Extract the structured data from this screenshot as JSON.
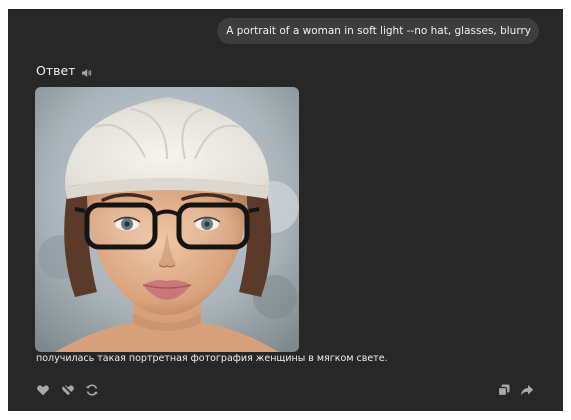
{
  "conversation": {
    "user_prompt": "A portrait of a woman in soft light --no hat, glasses, blurry",
    "answer_title": "Ответ",
    "image_caption": "получилась такая портретная фотография женщины в мягком свете."
  },
  "icons": {
    "speaker": "speaker-icon",
    "like": "heart-icon",
    "dislike": "broken-heart-icon",
    "regenerate": "refresh-icon",
    "copy": "copy-icon",
    "share": "share-icon"
  },
  "colors": {
    "window_background": "#272727",
    "bubble_background": "#3d3d3d",
    "text": "#f1f1f1",
    "icon": "#a9a9a9"
  }
}
